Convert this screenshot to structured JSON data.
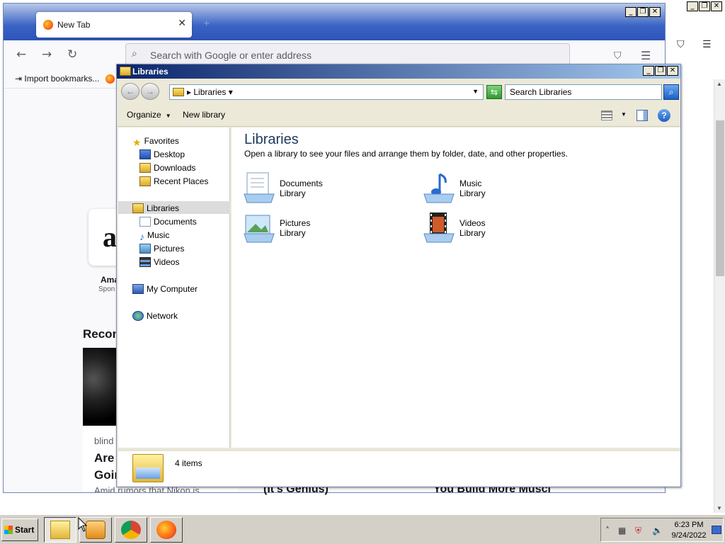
{
  "outer_controls": {
    "minimize": "_",
    "restore": "❐",
    "close": "✕"
  },
  "firefox": {
    "tab_title": "New Tab",
    "tab_close": "✕",
    "new_tab": "+",
    "back": "←",
    "forward": "→",
    "reload": "↻",
    "url_placeholder": "Search with Google or enter address",
    "pocket": "⛉",
    "menu": "☰",
    "import_bookmarks": "⇥ Import bookmarks...",
    "shortcut_initial": "a",
    "shortcut_name": "Ama",
    "shortcut_sponsor": "Spon",
    "section_title": "Recon",
    "story_source": "blind",
    "story_title_1": "Are",
    "story_title_2": "Goin",
    "story_excerpt": "Amid rumors that Nikon is",
    "story_peek_2": "(It's Genius)",
    "story_peek_3": "You Build More Muscl"
  },
  "explorer": {
    "title": "Libraries",
    "back": "←",
    "forward": "→",
    "breadcrumb": "▸ Libraries ▾",
    "address_dropdown": "▼",
    "search_placeholder": "Search Libraries",
    "search_go": "⌕",
    "refresh": "⇆",
    "organize": "Organize",
    "new_library": "New library",
    "dropdown_arrow": "▼",
    "help": "?",
    "nav": {
      "favorites": "Favorites",
      "desktop": "Desktop",
      "downloads": "Downloads",
      "recent_places": "Recent Places",
      "libraries": "Libraries",
      "documents": "Documents",
      "music": "Music",
      "pictures": "Pictures",
      "videos": "Videos",
      "my_computer": "My Computer",
      "network": "Network"
    },
    "heading": "Libraries",
    "description": "Open a library to see your files and arrange them by folder, date, and other properties.",
    "libraries": [
      {
        "name": "Documents",
        "kind": "Library"
      },
      {
        "name": "Music",
        "kind": "Library"
      },
      {
        "name": "Pictures",
        "kind": "Library"
      },
      {
        "name": "Videos",
        "kind": "Library"
      }
    ],
    "status": "4 items"
  },
  "taskbar": {
    "start": "Start",
    "tray_expand": "˄",
    "time": "6:23 PM",
    "date": "9/24/2022"
  }
}
